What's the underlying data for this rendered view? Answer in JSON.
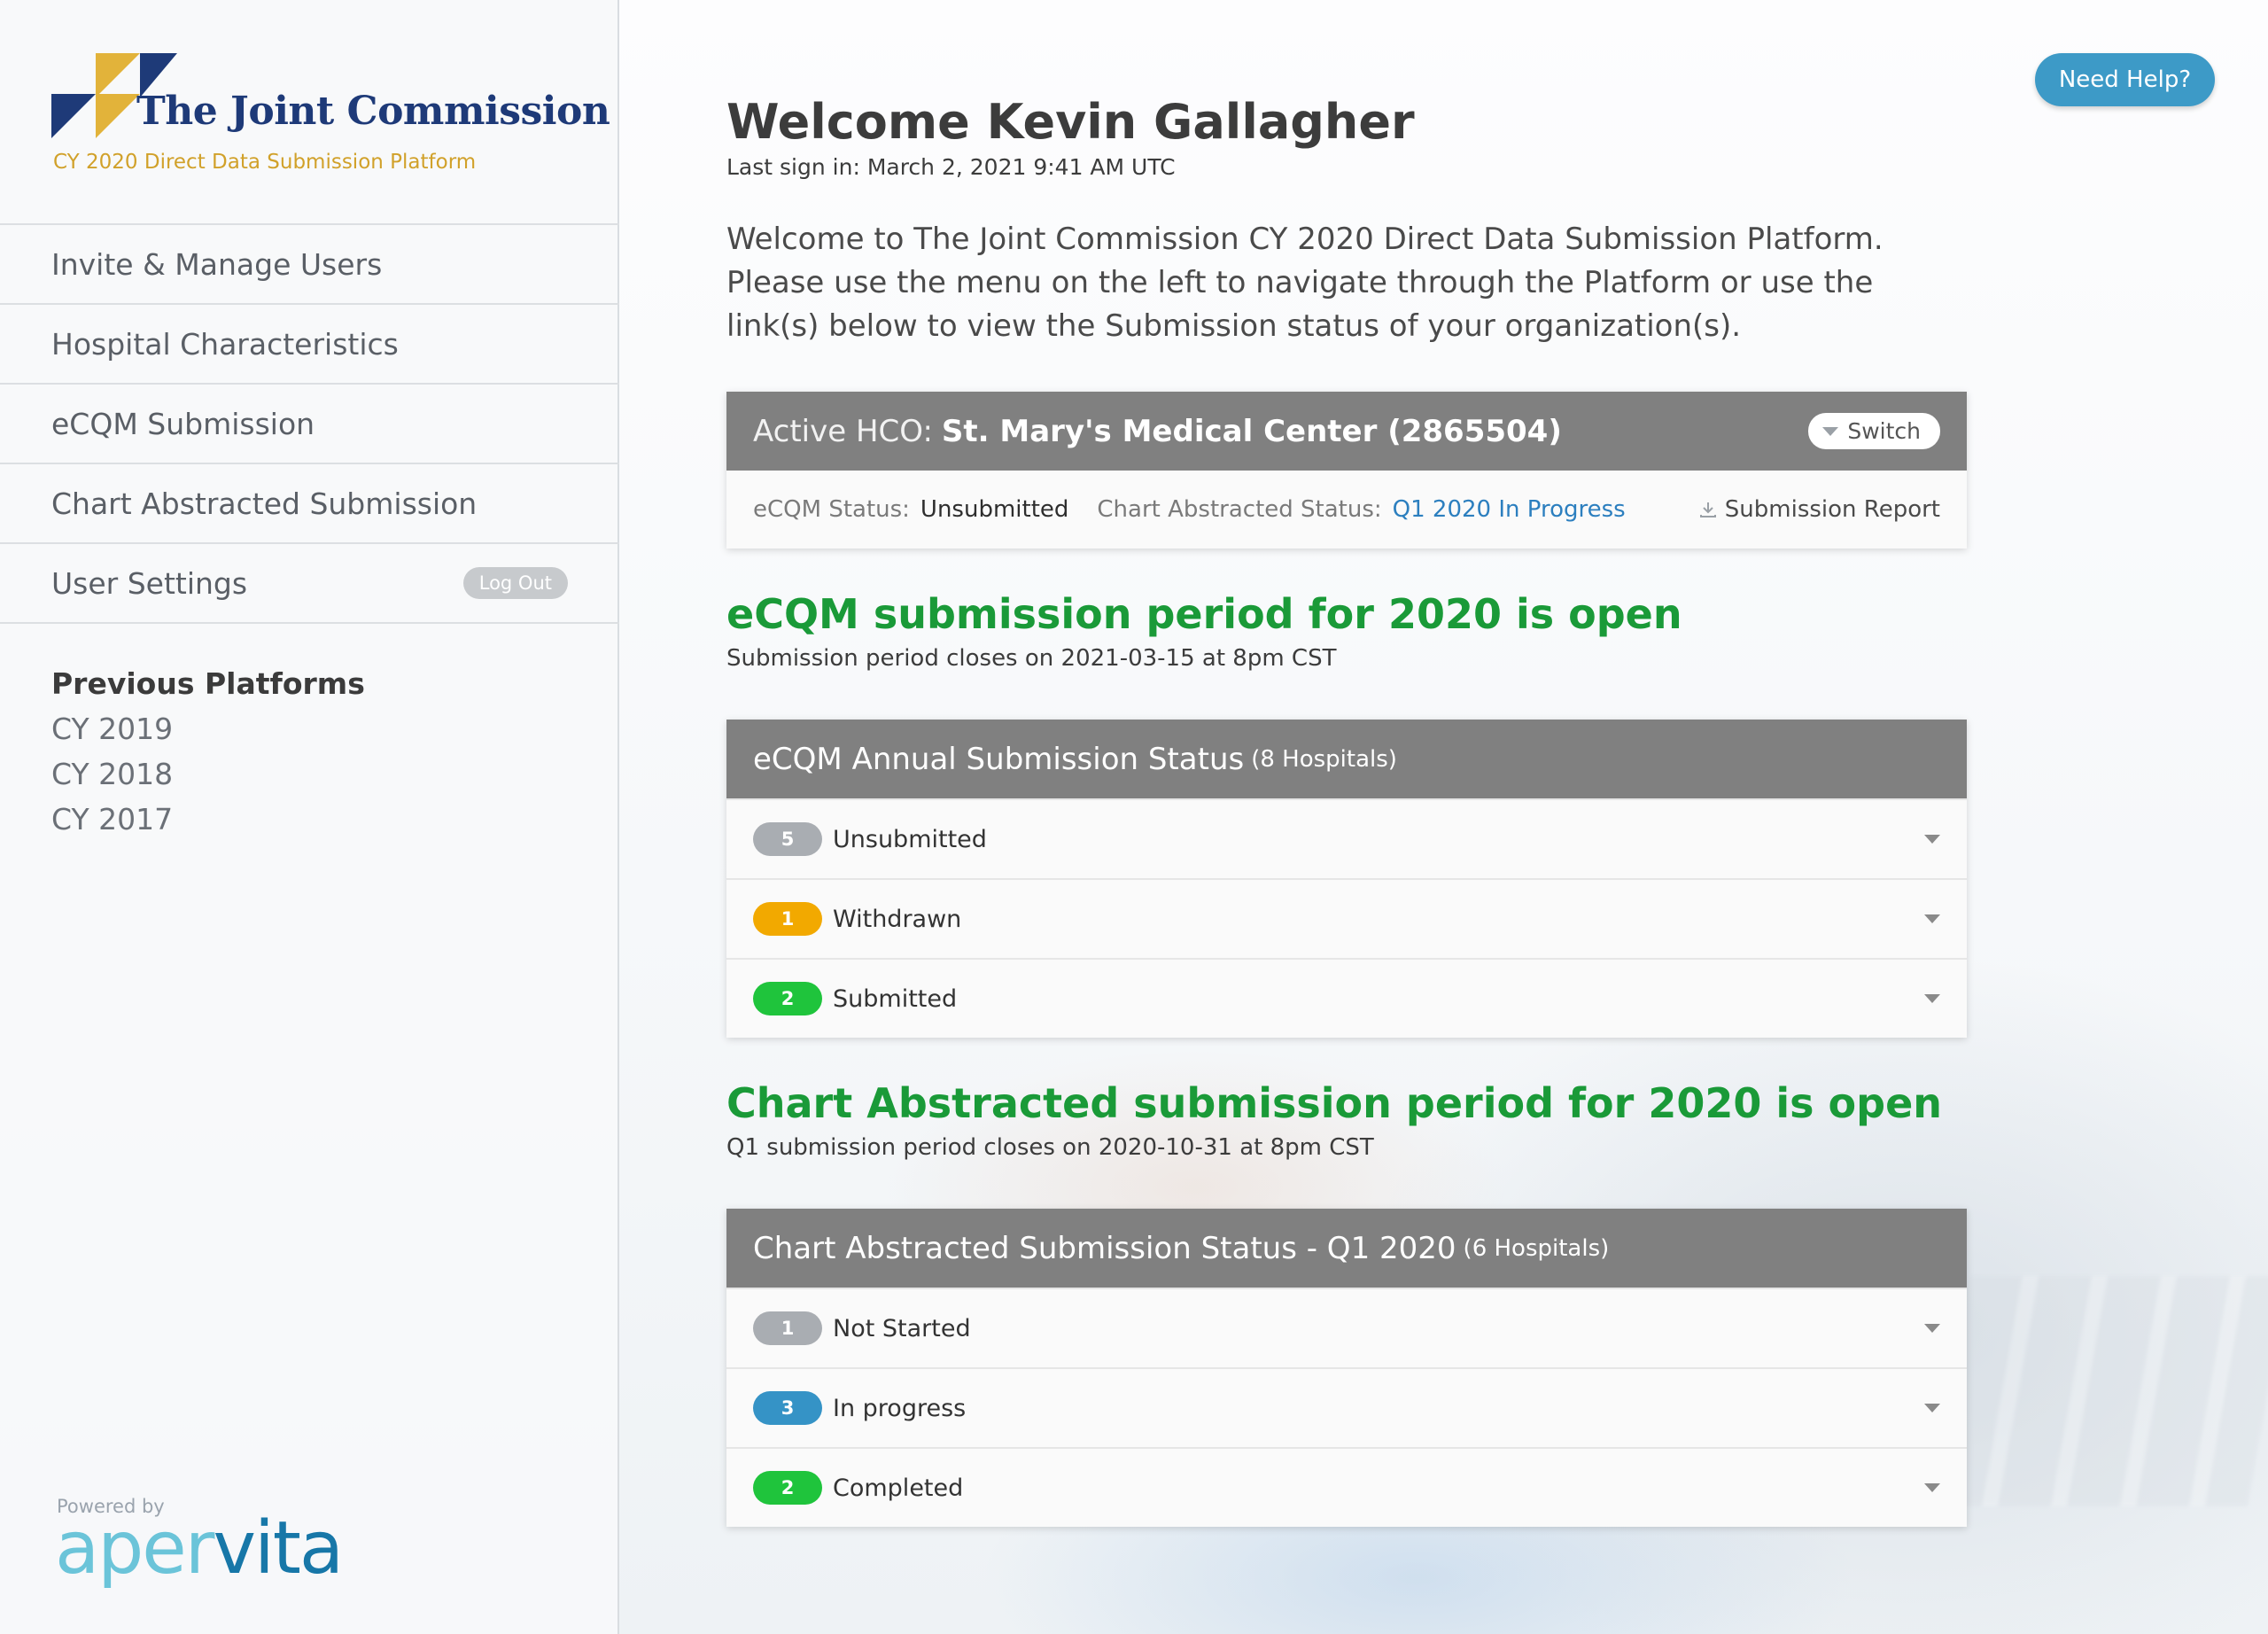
{
  "brand": {
    "name": "The Joint Commission",
    "subtitle": "CY 2020 Direct Data Submission Platform",
    "colors": {
      "navy": "#1e3a78",
      "gold": "#e2b33a"
    }
  },
  "sidebar": {
    "items": [
      {
        "label": "Invite & Manage Users"
      },
      {
        "label": "Hospital Characteristics"
      },
      {
        "label": "eCQM Submission"
      },
      {
        "label": "Chart Abstracted Submission"
      },
      {
        "label": "User Settings"
      }
    ],
    "logout_label": "Log Out",
    "previous_title": "Previous Platforms",
    "previous": [
      "CY 2019",
      "CY 2018",
      "CY 2017"
    ],
    "powered_by": "Powered by",
    "vendor": {
      "part1": "aper",
      "part2": "vita"
    }
  },
  "help_label": "Need Help?",
  "welcome": {
    "title": "Welcome Kevin Gallagher",
    "last_sign_in": "Last sign in: March 2, 2021 9:41 AM UTC",
    "intro": "Welcome to The Joint Commission CY 2020 Direct Data Submission Platform. Please use the menu on the left to navigate through the Platform or use the link(s) below to view the Submission status of your organization(s)."
  },
  "active_hco": {
    "prefix": "Active HCO:",
    "name": "St. Mary's Medical Center (2865504)",
    "switch_label": "Switch",
    "ecqm_status_label": "eCQM Status:",
    "ecqm_status_value": "Unsubmitted",
    "chart_status_label": "Chart Abstracted Status:",
    "chart_status_value": "Q1 2020 In Progress",
    "report_label": "Submission Report"
  },
  "ecqm": {
    "period_title": "eCQM submission period for 2020 is open",
    "period_sub": "Submission period closes on 2021-03-15 at 8pm CST",
    "card_title": "eCQM Annual Submission Status",
    "card_count": "(8 Hospitals)",
    "rows": [
      {
        "count": "5",
        "label": "Unsubmitted",
        "color": "#a9adb2"
      },
      {
        "count": "1",
        "label": "Withdrawn",
        "color": "#f2a900"
      },
      {
        "count": "2",
        "label": "Submitted",
        "color": "#1fc43c"
      }
    ]
  },
  "chart": {
    "period_title": "Chart Abstracted submission period for 2020 is open",
    "period_sub": "Q1 submission period closes on 2020-10-31 at 8pm CST",
    "card_title": "Chart Abstracted Submission Status - Q1 2020",
    "card_count": "(6 Hospitals)",
    "rows": [
      {
        "count": "1",
        "label": "Not Started",
        "color": "#a9adb2"
      },
      {
        "count": "3",
        "label": "In progress",
        "color": "#3593c6"
      },
      {
        "count": "2",
        "label": "Completed",
        "color": "#1fc43c"
      }
    ]
  }
}
